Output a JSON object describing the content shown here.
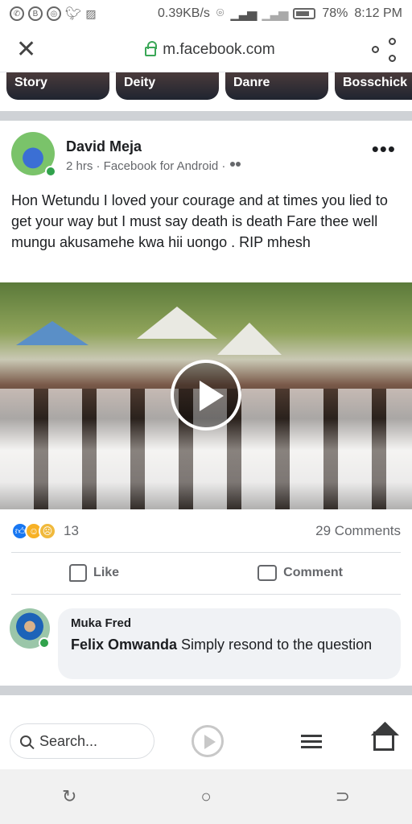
{
  "statusbar": {
    "network_speed": "0.39KB/s",
    "battery_percent": "78%",
    "time": "8:12 PM"
  },
  "browser": {
    "url": "m.facebook.com",
    "close_icon": "close-icon",
    "share_icon": "share-icon"
  },
  "stories": [
    {
      "label": "Story"
    },
    {
      "label": "Deity"
    },
    {
      "label": "Danre"
    },
    {
      "label": "Bosschick"
    }
  ],
  "post": {
    "author": "David Meja",
    "meta": "2 hrs · Facebook for Android ·",
    "text": "Hon Wetundu I loved your courage and at times you lied to get your way but I must say death is death Fare thee well mungu akusamehe kwa hii uongo . RIP mhesh",
    "reaction_count": "13",
    "comments_count": "29 Comments",
    "like_label": "Like",
    "comment_label": "Comment"
  },
  "comment": {
    "author": "Muka Fred",
    "mention": "Felix Omwanda",
    "text": " Simply resond to the question"
  },
  "bottom": {
    "search_placeholder": "Search..."
  },
  "colors": {
    "brand": "#1877f2",
    "online": "#31a24c"
  }
}
